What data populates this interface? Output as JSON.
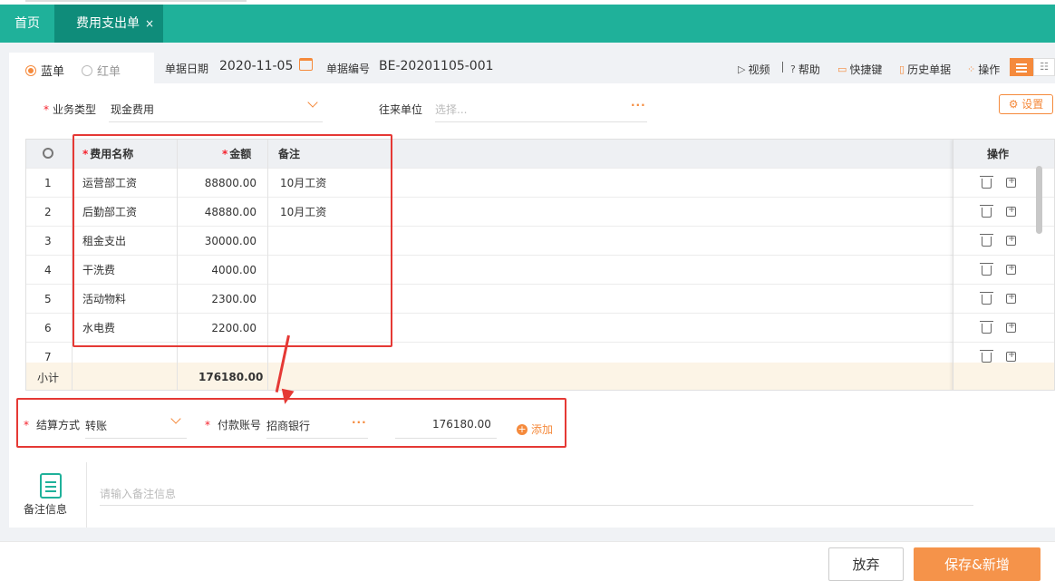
{
  "tabs": {
    "home": "首页",
    "doc": "费用支出单",
    "close": "×"
  },
  "header": {
    "radio_blue": "蓝单",
    "radio_red": "红单",
    "date_label": "单据日期",
    "date_value": "2020-11-05",
    "no_label": "单据编号",
    "no_value": "BE-20201105-001",
    "tools": [
      "视频",
      "帮助",
      "快捷键",
      "历史单据",
      "操作"
    ]
  },
  "form": {
    "biz_type_label": "业务类型",
    "biz_type_value": "现金费用",
    "partner_label": "往来单位",
    "partner_placeholder": "选择...",
    "settings_label": "设置"
  },
  "table": {
    "columns": {
      "name": "费用名称",
      "amount": "金额",
      "note": "备注",
      "ops": "操作"
    },
    "rows": [
      {
        "idx": "1",
        "name": "运营部工资",
        "amount": "88800.00",
        "note": "10月工资"
      },
      {
        "idx": "2",
        "name": "后勤部工资",
        "amount": "48880.00",
        "note": "10月工资"
      },
      {
        "idx": "3",
        "name": "租金支出",
        "amount": "30000.00",
        "note": ""
      },
      {
        "idx": "4",
        "name": "干洗费",
        "amount": "4000.00",
        "note": ""
      },
      {
        "idx": "5",
        "name": "活动物料",
        "amount": "2300.00",
        "note": ""
      },
      {
        "idx": "6",
        "name": "水电费",
        "amount": "2200.00",
        "note": ""
      },
      {
        "idx": "7",
        "name": "",
        "amount": "",
        "note": ""
      }
    ],
    "subtotal_label": "小计",
    "subtotal_value": "176180.00"
  },
  "payment": {
    "method_label": "结算方式",
    "method_value": "转账",
    "account_label": "付款账号",
    "account_value": "招商银行",
    "amount_value": "176180.00",
    "add_label": "添加"
  },
  "remark": {
    "label": "备注信息",
    "placeholder": "请输入备注信息"
  },
  "footer": {
    "cancel": "放弃",
    "save": "保存&新增"
  }
}
